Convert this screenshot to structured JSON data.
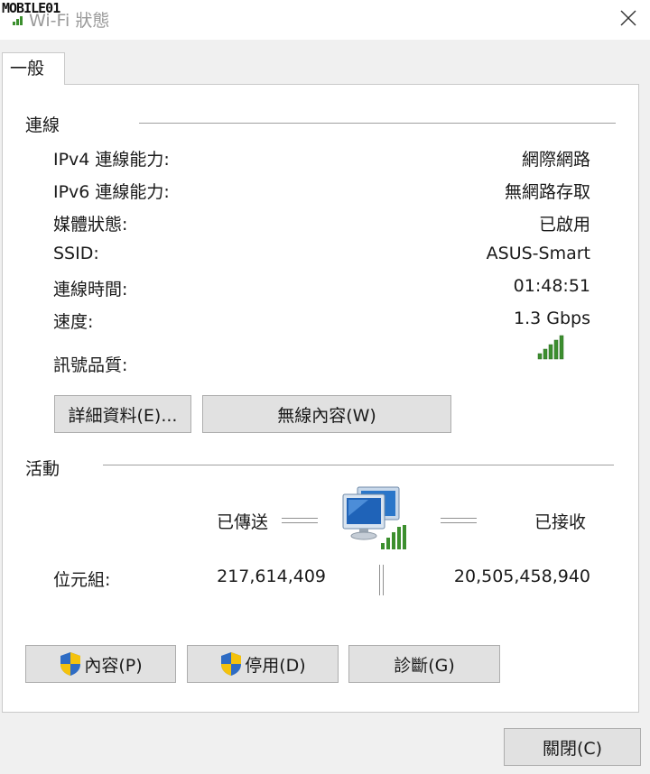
{
  "window": {
    "logo_text": "MOBILE01",
    "title": "Wi-Fi 狀態"
  },
  "tabs": [
    {
      "label": "一般"
    }
  ],
  "connection": {
    "section_title": "連線",
    "rows": [
      {
        "label": "IPv4 連線能力:",
        "value": "網際網路"
      },
      {
        "label": "IPv6 連線能力:",
        "value": "無網路存取"
      },
      {
        "label": "媒體狀態:",
        "value": "已啟用"
      },
      {
        "label": "SSID:",
        "value": "ASUS-Smart"
      },
      {
        "label": "連線時間:",
        "value": "01:48:51"
      },
      {
        "label": "速度:",
        "value": "1.3 Gbps"
      }
    ],
    "signal_label": "訊號品質:",
    "signal_bars": 5,
    "signal_max": 5,
    "details_button": "詳細資料(E)...",
    "wireless_button": "無線內容(W)"
  },
  "activity": {
    "section_title": "活動",
    "sent_label": "已傳送",
    "received_label": "已接收",
    "bytes_label": "位元組:",
    "bytes_sent": "217,614,409",
    "bytes_received": "20,505,458,940"
  },
  "buttons": {
    "properties": "內容(P)",
    "disable": "停用(D)",
    "diagnose": "診斷(G)",
    "close": "關閉(C)"
  },
  "colors": {
    "signal": "#3c8f2e",
    "shield_blue": "#2e6cc4",
    "shield_yellow": "#f4c20d"
  },
  "icons": {
    "close": "close-icon",
    "signal": "wifi-signal-icon",
    "network": "network-computers-icon",
    "shield": "uac-shield-icon"
  }
}
